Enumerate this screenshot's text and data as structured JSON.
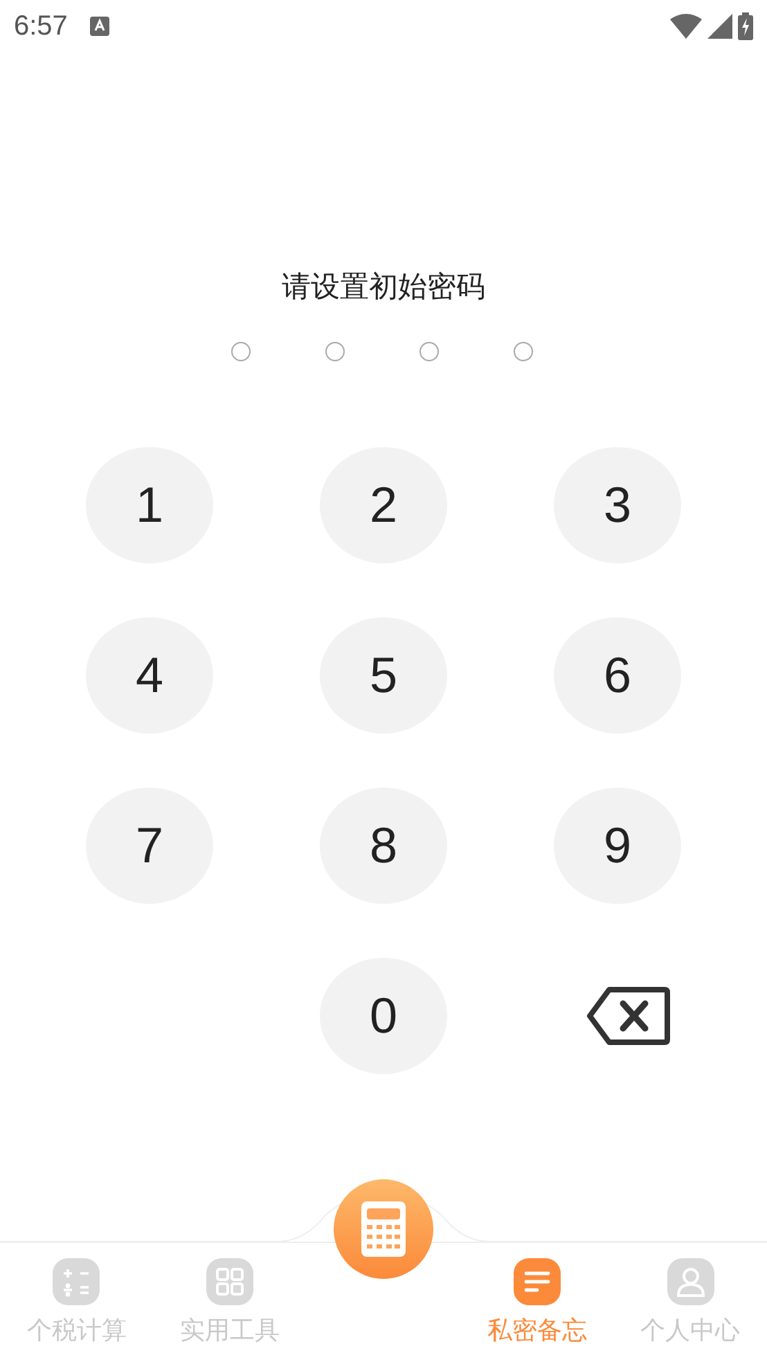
{
  "status_bar": {
    "time": "6:57"
  },
  "prompt": "请设置初始密码",
  "pin_dots": [
    {
      "filled": false
    },
    {
      "filled": false
    },
    {
      "filled": false
    },
    {
      "filled": false
    }
  ],
  "keys": [
    {
      "kind": "digit",
      "label": "1"
    },
    {
      "kind": "digit",
      "label": "2"
    },
    {
      "kind": "digit",
      "label": "3"
    },
    {
      "kind": "digit",
      "label": "4"
    },
    {
      "kind": "digit",
      "label": "5"
    },
    {
      "kind": "digit",
      "label": "6"
    },
    {
      "kind": "digit",
      "label": "7"
    },
    {
      "kind": "digit",
      "label": "8"
    },
    {
      "kind": "digit",
      "label": "9"
    },
    {
      "kind": "blank"
    },
    {
      "kind": "digit",
      "label": "0"
    },
    {
      "kind": "backspace"
    }
  ],
  "tabs": [
    {
      "kind": "calc",
      "label": "个税计算",
      "selected": false
    },
    {
      "kind": "tools",
      "label": "实用工具",
      "selected": false
    },
    {
      "kind": "center"
    },
    {
      "kind": "memo",
      "label": "私密备忘",
      "selected": true
    },
    {
      "kind": "user",
      "label": "个人中心",
      "selected": false
    }
  ]
}
